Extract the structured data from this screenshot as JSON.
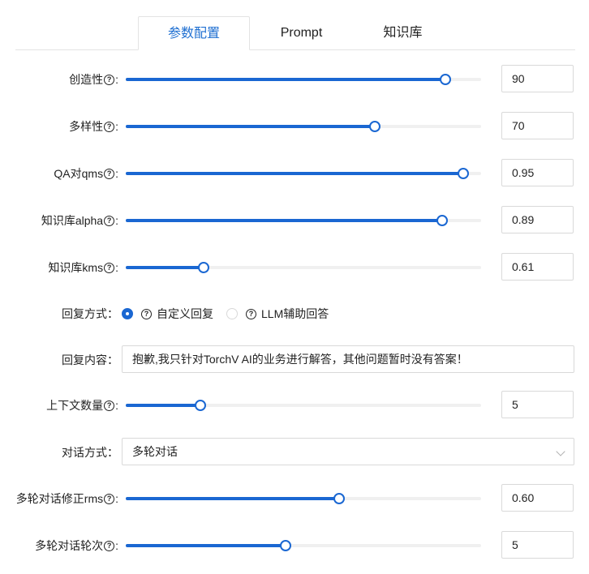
{
  "tabs": [
    {
      "label": "参数配置",
      "active": true
    },
    {
      "label": "Prompt",
      "active": false
    },
    {
      "label": "知识库",
      "active": false
    }
  ],
  "help_glyph": "?",
  "colon": ":",
  "colon_cn": "：",
  "accent_color": "#1a67d2",
  "sliders": {
    "creativity": {
      "label": "创造性",
      "value": "90",
      "fraction": 0.9
    },
    "diversity": {
      "label": "多样性",
      "value": "70",
      "fraction": 0.7
    },
    "qa_qms": {
      "label": "QA对qms",
      "value": "0.95",
      "fraction": 0.95
    },
    "kb_alpha": {
      "label": "知识库alpha",
      "value": "0.89",
      "fraction": 0.89
    },
    "kb_kms": {
      "label": "知识库kms",
      "value": "0.61",
      "fraction": 0.22
    },
    "context_count": {
      "label": "上下文数量",
      "value": "5",
      "fraction": 0.21
    },
    "multi_rms": {
      "label": "多轮对话修正rms",
      "value": "0.60",
      "fraction": 0.6
    },
    "multi_turns": {
      "label": "多轮对话轮次",
      "value": "5",
      "fraction": 0.45
    }
  },
  "reply_mode": {
    "label": "回复方式",
    "options": [
      {
        "label": "自定义回复",
        "selected": true
      },
      {
        "label": "LLM辅助回答",
        "selected": false
      }
    ]
  },
  "reply_content": {
    "label": "回复内容",
    "value": "抱歉,我只针对TorchV AI的业务进行解答，其他问题暂时没有答案！"
  },
  "dialog_mode": {
    "label": "对话方式",
    "value": "多轮对话"
  }
}
